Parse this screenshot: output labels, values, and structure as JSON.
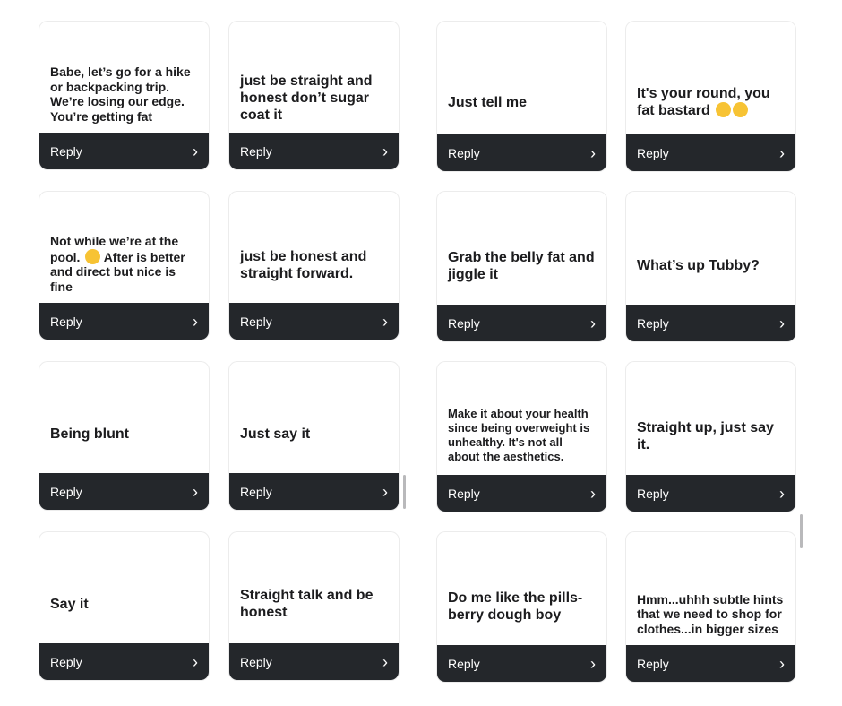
{
  "reply_label": "Reply",
  "chevron": "›",
  "cards": [
    {
      "text": "Babe, let’s go for a hike or backpacking trip. We’re losing our edge. You’re getting fat"
    },
    {
      "text": "just be straight and honest don’t sugar coat it"
    },
    {
      "text": "Just tell me"
    },
    {
      "text": "It's your round, you fat bastard",
      "emojis": [
        "winking-face",
        "grinning-face"
      ]
    },
    {
      "text": "Not while we’re at the pool.",
      "emoji": "tongue-face",
      "text_after": " After is better and direct but nice is fine"
    },
    {
      "text": "just be honest and straight forward."
    },
    {
      "text": "Grab the belly fat and jiggle it"
    },
    {
      "text": "What’s up Tubby?"
    },
    {
      "text": "Being blunt"
    },
    {
      "text": "Just say it"
    },
    {
      "text": "Make it about your health since being overweight is unhealthy. It's not all about the aesthetics."
    },
    {
      "text": "Straight up, just say it."
    },
    {
      "text": "Say it"
    },
    {
      "text": "Straight talk and be honest"
    },
    {
      "text": "Do me like the pills-berry dough boy"
    },
    {
      "text": "Hmm...uhhh subtle hints that we need to shop for clothes...in bigger sizes"
    }
  ],
  "colors": {
    "reply_bar": "#24272b",
    "card_text": "#1c1c1e",
    "emoji": "#f7c334"
  }
}
